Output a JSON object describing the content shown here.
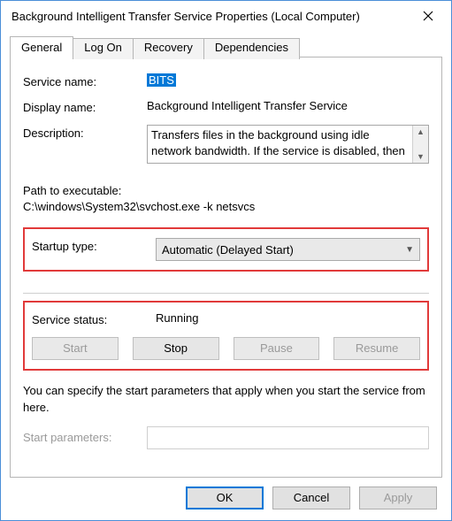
{
  "window": {
    "title": "Background Intelligent Transfer Service Properties (Local Computer)"
  },
  "tabs": {
    "t0": "General",
    "t1": "Log On",
    "t2": "Recovery",
    "t3": "Dependencies"
  },
  "labels": {
    "service_name": "Service name:",
    "display_name": "Display name:",
    "description": "Description:",
    "path": "Path to executable:",
    "startup_type": "Startup type:",
    "service_status": "Service status:",
    "start_params": "Start parameters:"
  },
  "values": {
    "service_name": "BITS",
    "display_name": "Background Intelligent Transfer Service",
    "description": "Transfers files in the background using idle network bandwidth. If the service is disabled, then any",
    "path": "C:\\windows\\System32\\svchost.exe -k netsvcs",
    "startup_type": "Automatic (Delayed Start)",
    "service_status": "Running",
    "start_params": ""
  },
  "buttons": {
    "start": "Start",
    "stop": "Stop",
    "pause": "Pause",
    "resume": "Resume",
    "ok": "OK",
    "cancel": "Cancel",
    "apply": "Apply"
  },
  "help": "You can specify the start parameters that apply when you start the service from here."
}
